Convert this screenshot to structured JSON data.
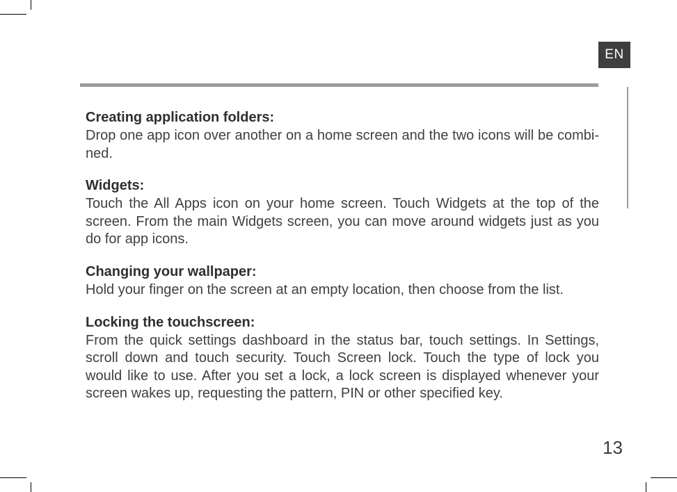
{
  "language_tab": "EN",
  "sections": [
    {
      "heading": "Creating application folders:",
      "body": "Drop one app icon over another on a home screen and the two icons will be combi­ned."
    },
    {
      "heading": "Widgets:",
      "body": "Touch the All Apps icon on your home screen. Touch Widgets at the top of the screen. From the main Widgets screen, you can move around widgets just as you do for app icons."
    },
    {
      "heading": "Changing your wallpaper:",
      "body": "Hold your finger on the screen at an empty location, then choose from the list."
    },
    {
      "heading": "Locking the touchscreen:",
      "body": "From the quick settings dashboard in the status bar, touch settings. In Settings, scroll down and touch security. Touch Screen lock. Touch the type of lock you would like to use. After you set a lock, a lock screen is displayed whenever your screen wakes up, requesting the pattern, PIN or other specified key."
    }
  ],
  "page_number": "13"
}
